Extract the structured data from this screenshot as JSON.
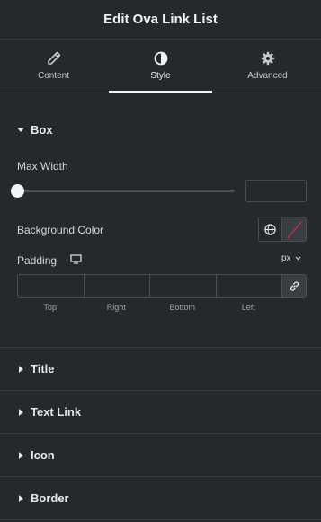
{
  "header": {
    "title": "Edit Ova Link List"
  },
  "tabs": [
    {
      "label": "Content",
      "icon": "pencil-icon",
      "active": false
    },
    {
      "label": "Style",
      "icon": "half-circle-icon",
      "active": true
    },
    {
      "label": "Advanced",
      "icon": "gear-icon",
      "active": false
    }
  ],
  "box_section": {
    "title": "Box",
    "max_width": {
      "label": "Max Width",
      "value": "",
      "slider_fraction": 0
    },
    "background_color": {
      "label": "Background Color",
      "value": ""
    },
    "padding": {
      "label": "Padding",
      "unit": "px",
      "fields": [
        {
          "label": "Top",
          "value": ""
        },
        {
          "label": "Right",
          "value": ""
        },
        {
          "label": "Bottom",
          "value": ""
        },
        {
          "label": "Left",
          "value": ""
        }
      ]
    }
  },
  "collapsed_sections": [
    {
      "title": "Title"
    },
    {
      "title": "Text Link"
    },
    {
      "title": "Icon"
    },
    {
      "title": "Border"
    }
  ],
  "colors": {
    "panel_bg": "#26292c",
    "divider": "#3a3d41",
    "text": "#d5dadf",
    "accent_none": "#d72b3f"
  }
}
